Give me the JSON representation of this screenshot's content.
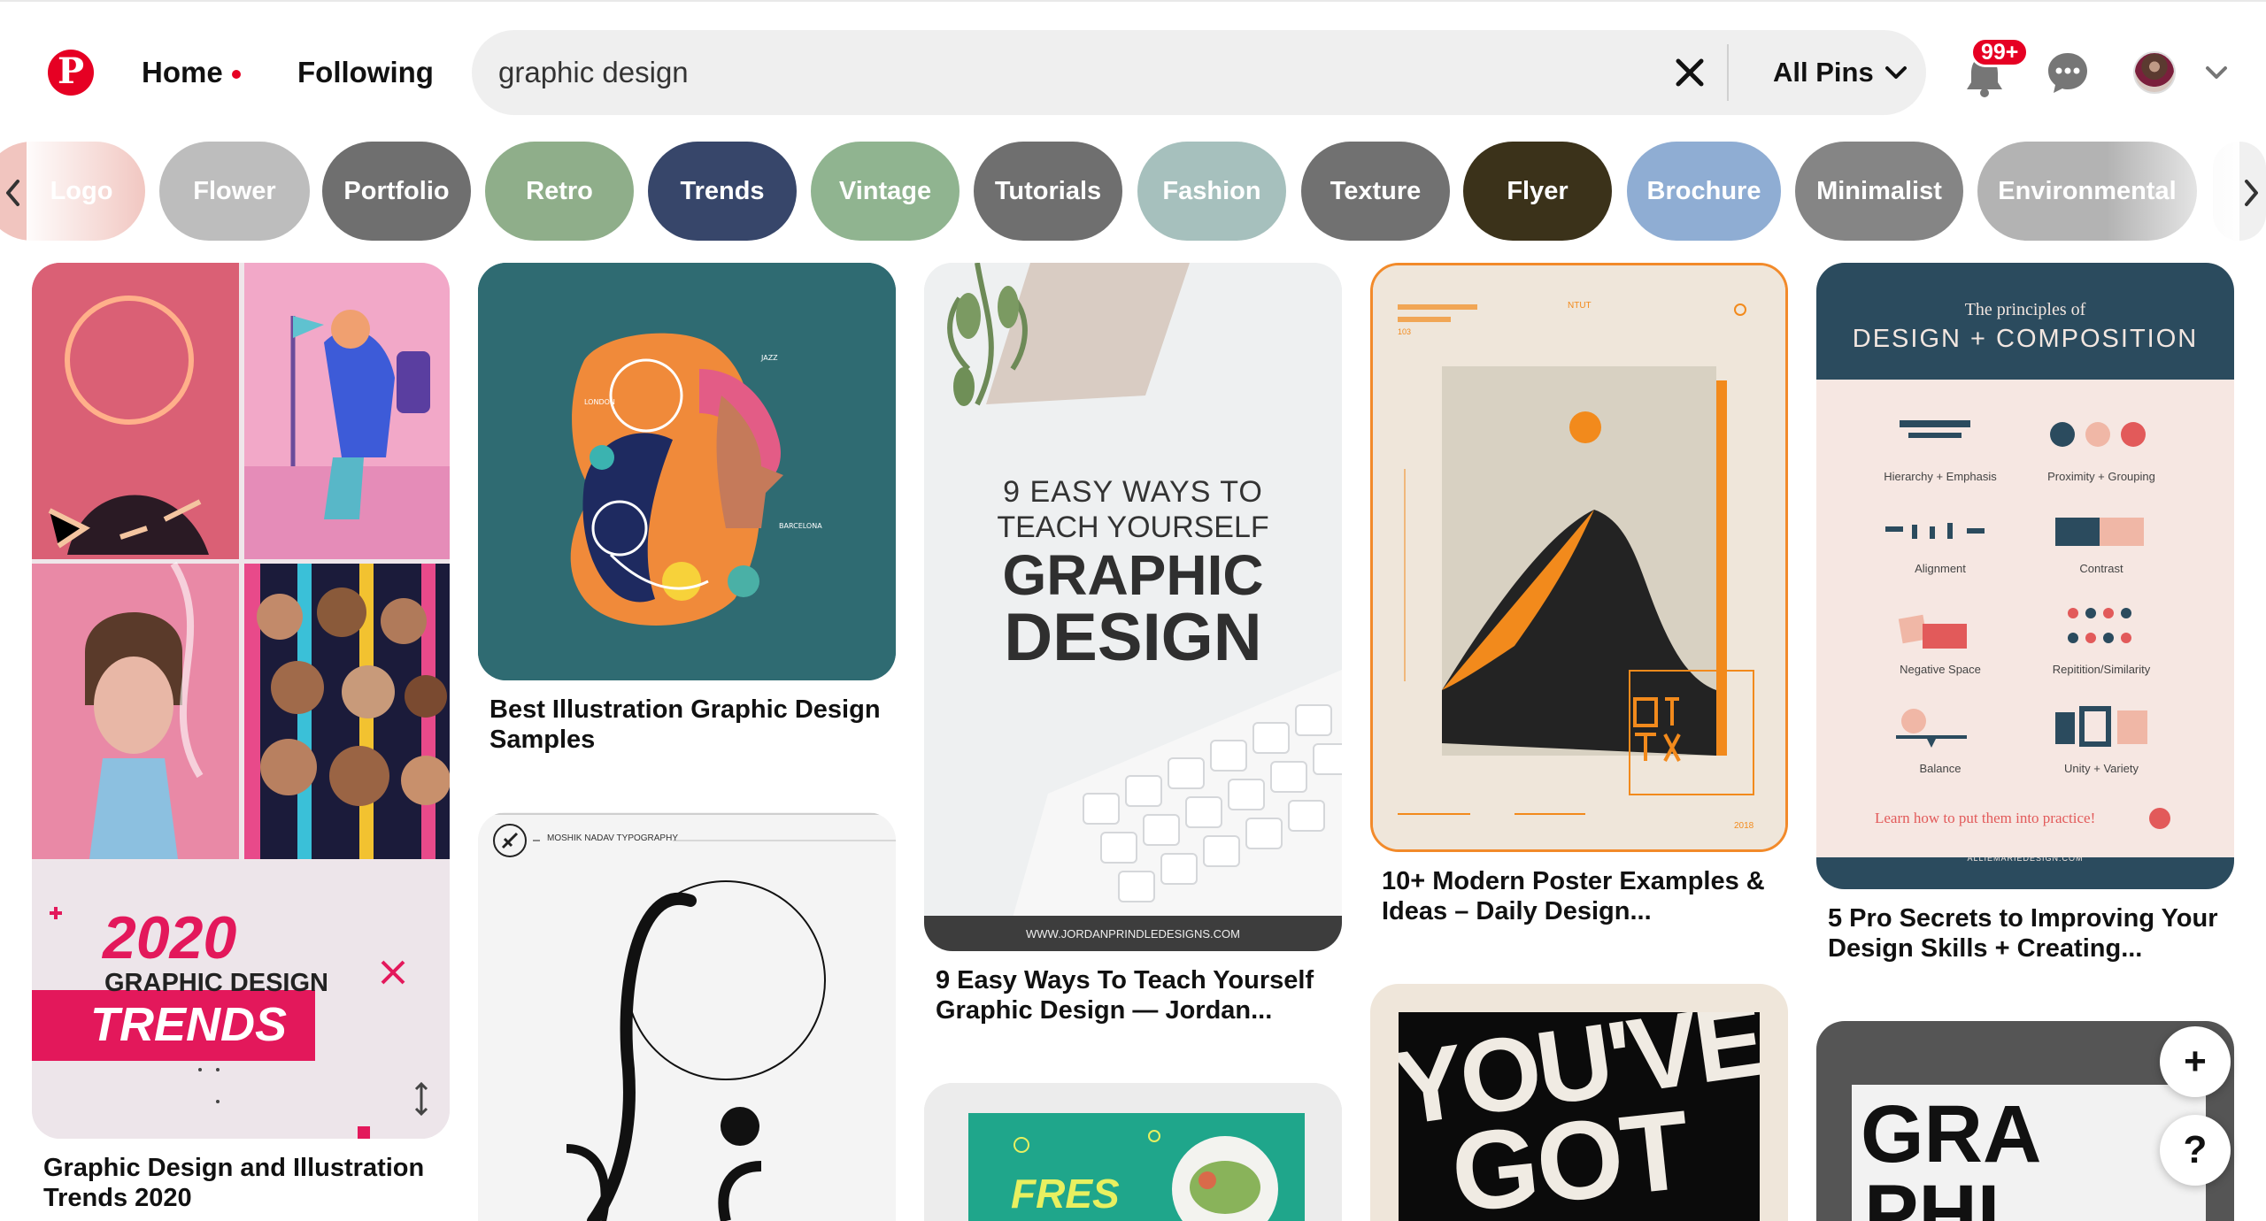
{
  "header": {
    "logo_letter": "P",
    "nav": {
      "home": "Home",
      "following": "Following"
    },
    "search": {
      "value": "graphic design",
      "filter_label": "All Pins"
    },
    "notifications_badge": "99+"
  },
  "chips": [
    {
      "label": "Logo",
      "color": "#e8a7a0"
    },
    {
      "label": "Flower",
      "color": "#b9b9b9"
    },
    {
      "label": "Portfolio",
      "color": "#6f6f6f"
    },
    {
      "label": "Retro",
      "color": "#8fae8a"
    },
    {
      "label": "Trends",
      "color": "#37466a"
    },
    {
      "label": "Vintage",
      "color": "#90b490"
    },
    {
      "label": "Tutorials",
      "color": "#6f6f6f"
    },
    {
      "label": "Fashion",
      "color": "#a6c0bd"
    },
    {
      "label": "Texture",
      "color": "#717171"
    },
    {
      "label": "Flyer",
      "color": "#3b321a"
    },
    {
      "label": "Brochure",
      "color": "#8fadd3"
    },
    {
      "label": "Minimalist",
      "color": "#858585"
    },
    {
      "label": "Environmental",
      "color": "#b3b3b3"
    }
  ],
  "pins": {
    "trends": {
      "title": "Graphic Design and Illustration Trends 2020",
      "year": "2020",
      "line1": "GRAPHIC DESIGN",
      "line2": "TRENDS"
    },
    "illustration": {
      "title": "Best Illustration Graphic Design Samples"
    },
    "typography": {
      "caption": "MOSHIK NADAV TYPOGRAPHY"
    },
    "teach": {
      "title": "9 Easy Ways To Teach Yourself Graphic Design — Jordan...",
      "line1": "9 EASY WAYS TO",
      "line2": "TEACH YOURSELF",
      "line3": "GRAPHIC",
      "line4": "DESIGN",
      "url": "WWW.JORDANPRINDLEDESIGNS.COM"
    },
    "fresh": {
      "word": "FRES"
    },
    "poster": {
      "title": "10+ Modern Poster Examples & Ideas – Daily Design...",
      "school": "NTUT",
      "year": "2018",
      "code": "103"
    },
    "youve": {
      "line1": "YOU'VE",
      "line2": "GOT"
    },
    "principles": {
      "title": "5 Pro Secrets to Improving Your Design Skills + Creating...",
      "heading_small": "The principles of",
      "heading_big": "DESIGN + COMPOSITION",
      "items": [
        "Hierarchy + Emphasis",
        "Proximity + Grouping",
        "Alignment",
        "Contrast",
        "Negative Space",
        "Repitition/Similarity",
        "Balance",
        "Unity + Variety"
      ],
      "cta": "Learn how to put them into practice!",
      "url": "ALLIEMARIEDESIGN.COM"
    },
    "graphic": {
      "line1": "GRA",
      "line2": "PHI"
    }
  },
  "floating": {
    "add": "+",
    "help": "?"
  },
  "colors": {
    "brand": "#e60023"
  }
}
